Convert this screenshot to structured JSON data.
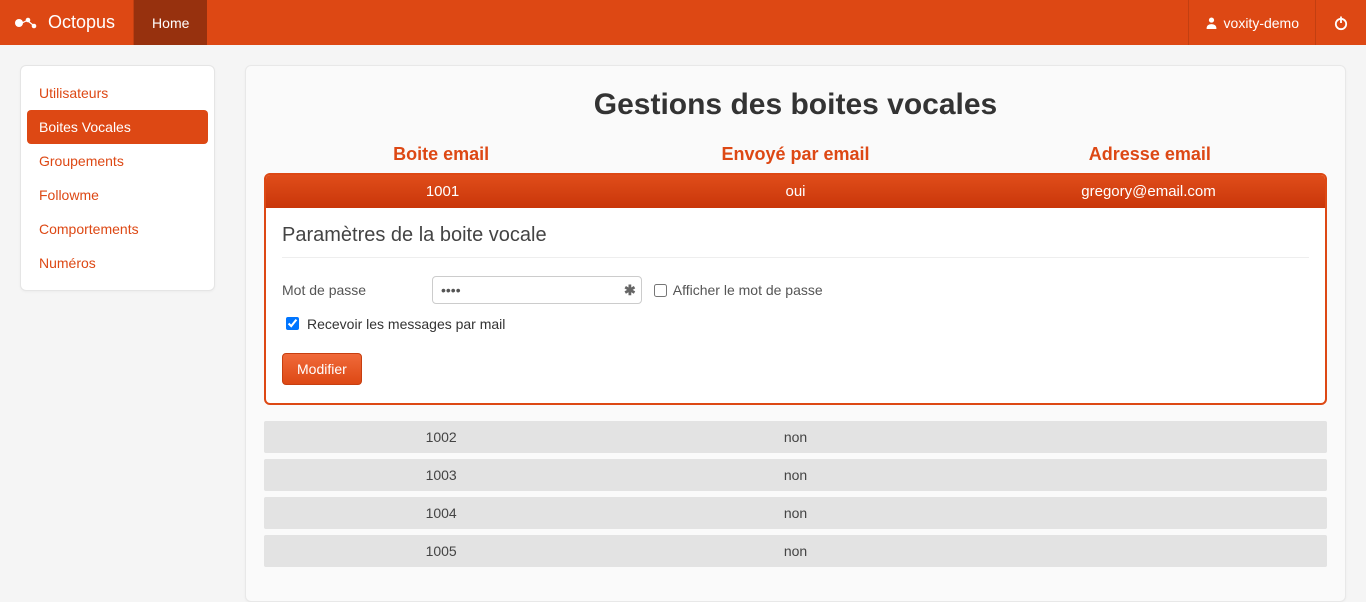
{
  "app": {
    "brand": "Octopus",
    "nav_home_label": "Home",
    "user_label": "voxity-demo"
  },
  "sidebar": {
    "items": [
      {
        "label": "Utilisateurs",
        "active": false
      },
      {
        "label": "Boites Vocales",
        "active": true
      },
      {
        "label": "Groupements",
        "active": false
      },
      {
        "label": "Followme",
        "active": false
      },
      {
        "label": "Comportements",
        "active": false
      },
      {
        "label": "Numéros",
        "active": false
      }
    ]
  },
  "page": {
    "title": "Gestions des boites vocales",
    "columns": {
      "box": "Boite email",
      "sent": "Envoyé par email",
      "address": "Adresse email"
    }
  },
  "selected": {
    "box": "1001",
    "sent": "oui",
    "address": "gregory@email.com",
    "panel_title": "Paramètres de la boite vocale",
    "password_label": "Mot de passe",
    "password_value": "••••",
    "show_password_label": "Afficher le mot de passe",
    "show_password_checked": false,
    "receive_mail_label": "Recevoir les messages par mail",
    "receive_mail_checked": true,
    "modify_label": "Modifier"
  },
  "rows": [
    {
      "box": "1002",
      "sent": "non",
      "address": ""
    },
    {
      "box": "1003",
      "sent": "non",
      "address": ""
    },
    {
      "box": "1004",
      "sent": "non",
      "address": ""
    },
    {
      "box": "1005",
      "sent": "non",
      "address": ""
    }
  ]
}
